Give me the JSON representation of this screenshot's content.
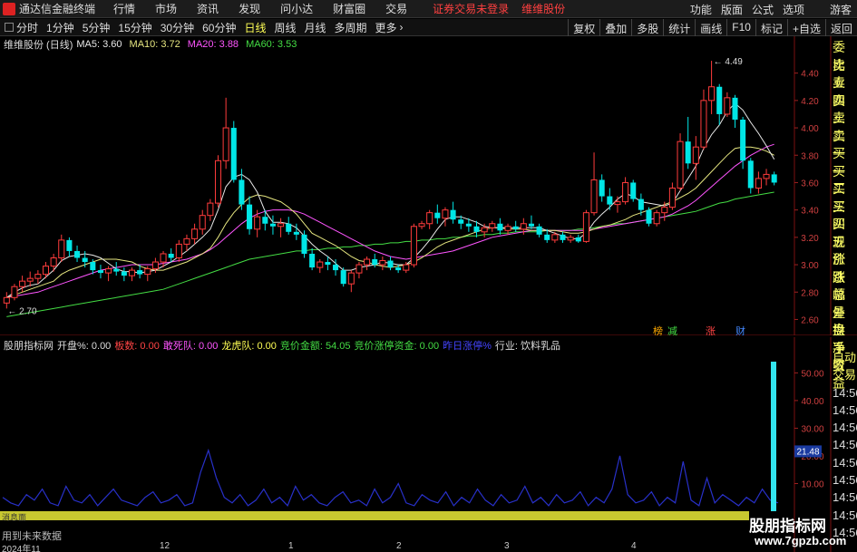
{
  "menubar": {
    "app_title": "通达信金融终端",
    "menus": [
      "行情",
      "市场",
      "资讯",
      "发现",
      "问小达",
      "财富圈",
      "交易"
    ],
    "login_status": "证券交易未登录",
    "stock_name": "维维股份",
    "right_menus": [
      "功能",
      "版面",
      "公式",
      "选项"
    ],
    "guest": "游客"
  },
  "toolbar": {
    "periods": [
      "分时",
      "1分钟",
      "5分钟",
      "15分钟",
      "30分钟",
      "60分钟",
      "日线",
      "周线",
      "月线",
      "多周期",
      "更多"
    ],
    "active_period": "日线",
    "right_buttons": [
      "复权",
      "叠加",
      "多股",
      "统计",
      "画线",
      "F10",
      "标记",
      "+自选",
      "返回"
    ]
  },
  "main_legend": {
    "title": "维维股份 (日线)",
    "ma5": "MA5: 3.60",
    "ma10": "MA10: 3.72",
    "ma20": "MA20: 3.88",
    "ma60": "MA60: 3.53",
    "colors": {
      "ma5": "#e8e8e8",
      "ma10": "#e6e680",
      "ma20": "#ff55ff",
      "ma60": "#44dd44"
    }
  },
  "sub_legend": {
    "title": "股朋指标网",
    "kaipan": "开盘%: 0.00",
    "banshu": "板数: 0.00",
    "gansidui": "敢死队: 0.00",
    "longhudui": "龙虎队: 0.00",
    "jingjiajine": "竞价金额: 54.05",
    "jingjiazhangting": "竞价涨停资金: 0.00",
    "zuorizhangting": "昨日涨停%",
    "industry": "行业: 饮料乳品"
  },
  "price_axis": [
    "4.40",
    "4.20",
    "4.00",
    "3.80",
    "3.60",
    "3.40",
    "3.20",
    "3.00",
    "2.80",
    "2.60"
  ],
  "sub_axis": [
    "50.00",
    "40.00",
    "30.00",
    "20.00",
    "10.00"
  ],
  "highlighted_value": "21.48",
  "annotations": {
    "high": "4.49",
    "low": "2.70"
  },
  "event_tags": [
    "榜",
    "减",
    "涨",
    "财"
  ],
  "side_panel": [
    "委比",
    "卖五",
    "卖四",
    "卖三",
    "卖二",
    "卖一",
    "买一",
    "买二",
    "买三",
    "买四",
    "买五",
    "现价",
    "涨跌",
    "涨幅",
    "总量",
    "外盘",
    "换手",
    "净资",
    "收益"
  ],
  "side_panel2": [
    "自动",
    "交易",
    "14:56",
    "14:56",
    "14:56",
    "14:56",
    "14:56",
    "14:56",
    "14:56",
    "14:56",
    "14:56"
  ],
  "scrollbar_label": "消息面",
  "future_label": "用到未来数据",
  "x_labels": [
    "2024年11",
    "12",
    "1",
    "2",
    "3",
    "4"
  ],
  "watermark": {
    "line1": "股朋指标网",
    "line2": "www.7gpzb.com"
  },
  "chart_data": {
    "type": "candlestick",
    "title": "维维股份 (日线)",
    "ylim": [
      2.55,
      4.55
    ],
    "candles": [
      [
        2.72,
        2.8,
        2.68,
        2.76
      ],
      [
        2.76,
        2.86,
        2.74,
        2.84
      ],
      [
        2.84,
        2.92,
        2.8,
        2.88
      ],
      [
        2.88,
        2.95,
        2.84,
        2.9
      ],
      [
        2.9,
        2.96,
        2.86,
        2.93
      ],
      [
        2.93,
        3.02,
        2.9,
        2.99
      ],
      [
        2.99,
        3.08,
        2.95,
        3.05
      ],
      [
        3.05,
        3.22,
        3.02,
        3.18
      ],
      [
        3.18,
        3.2,
        3.06,
        3.1
      ],
      [
        3.1,
        3.14,
        3.02,
        3.05
      ],
      [
        3.05,
        3.1,
        2.98,
        3.02
      ],
      [
        3.02,
        3.04,
        2.93,
        2.96
      ],
      [
        2.96,
        3.0,
        2.9,
        2.94
      ],
      [
        2.94,
        2.99,
        2.88,
        2.97
      ],
      [
        2.97,
        3.02,
        2.92,
        2.95
      ],
      [
        2.95,
        2.98,
        2.88,
        2.92
      ],
      [
        2.92,
        2.98,
        2.88,
        2.96
      ],
      [
        2.96,
        3.0,
        2.9,
        2.93
      ],
      [
        2.93,
        2.99,
        2.88,
        2.97
      ],
      [
        2.97,
        3.05,
        2.94,
        3.02
      ],
      [
        3.02,
        3.1,
        2.98,
        3.08
      ],
      [
        3.08,
        3.12,
        3.02,
        3.05
      ],
      [
        3.05,
        3.18,
        3.02,
        3.15
      ],
      [
        3.15,
        3.22,
        3.1,
        3.19
      ],
      [
        3.19,
        3.3,
        3.15,
        3.26
      ],
      [
        3.26,
        3.4,
        3.22,
        3.36
      ],
      [
        3.36,
        3.48,
        3.32,
        3.45
      ],
      [
        3.45,
        3.8,
        3.42,
        3.76
      ],
      [
        3.76,
        4.22,
        3.7,
        4.0
      ],
      [
        4.0,
        4.05,
        3.6,
        3.62
      ],
      [
        3.62,
        3.7,
        3.4,
        3.44
      ],
      [
        3.44,
        3.5,
        3.22,
        3.26
      ],
      [
        3.26,
        3.4,
        3.2,
        3.35
      ],
      [
        3.35,
        3.4,
        3.25,
        3.3
      ],
      [
        3.3,
        3.36,
        3.22,
        3.28
      ],
      [
        3.28,
        3.34,
        3.2,
        3.3
      ],
      [
        3.3,
        3.35,
        3.22,
        3.24
      ],
      [
        3.24,
        3.3,
        3.18,
        3.22
      ],
      [
        3.22,
        3.25,
        3.05,
        3.08
      ],
      [
        3.08,
        3.12,
        2.96,
        2.98
      ],
      [
        2.98,
        3.04,
        2.94,
        3.02
      ],
      [
        3.02,
        3.06,
        2.96,
        3.0
      ],
      [
        3.0,
        3.04,
        2.92,
        2.96
      ],
      [
        2.96,
        2.98,
        2.84,
        2.86
      ],
      [
        2.86,
        2.96,
        2.8,
        2.94
      ],
      [
        2.94,
        3.02,
        2.9,
        3.0
      ],
      [
        3.0,
        3.06,
        2.96,
        3.04
      ],
      [
        3.04,
        3.08,
        2.98,
        3.0
      ],
      [
        3.0,
        3.06,
        2.96,
        3.03
      ],
      [
        3.03,
        3.06,
        2.96,
        2.98
      ],
      [
        2.98,
        3.0,
        2.94,
        2.96
      ],
      [
        2.96,
        3.02,
        2.94,
        3.0
      ],
      [
        3.0,
        3.3,
        2.98,
        3.28
      ],
      [
        3.28,
        3.32,
        3.26,
        3.3
      ],
      [
        3.3,
        3.4,
        3.26,
        3.38
      ],
      [
        3.38,
        3.44,
        3.3,
        3.34
      ],
      [
        3.34,
        3.42,
        3.28,
        3.4
      ],
      [
        3.4,
        3.46,
        3.3,
        3.33
      ],
      [
        3.33,
        3.36,
        3.26,
        3.3
      ],
      [
        3.3,
        3.34,
        3.24,
        3.28
      ],
      [
        3.28,
        3.32,
        3.2,
        3.24
      ],
      [
        3.24,
        3.3,
        3.2,
        3.27
      ],
      [
        3.27,
        3.32,
        3.24,
        3.3
      ],
      [
        3.3,
        3.34,
        3.22,
        3.25
      ],
      [
        3.25,
        3.3,
        3.22,
        3.28
      ],
      [
        3.28,
        3.32,
        3.24,
        3.26
      ],
      [
        3.26,
        3.34,
        3.22,
        3.3
      ],
      [
        3.3,
        3.36,
        3.26,
        3.28
      ],
      [
        3.28,
        3.3,
        3.2,
        3.22
      ],
      [
        3.22,
        3.26,
        3.16,
        3.18
      ],
      [
        3.18,
        3.24,
        3.16,
        3.22
      ],
      [
        3.22,
        3.24,
        3.16,
        3.18
      ],
      [
        3.18,
        3.22,
        3.16,
        3.2
      ],
      [
        3.2,
        3.22,
        3.16,
        3.17
      ],
      [
        3.17,
        3.4,
        3.16,
        3.38
      ],
      [
        3.38,
        3.82,
        3.36,
        3.62
      ],
      [
        3.62,
        3.66,
        3.46,
        3.5
      ],
      [
        3.5,
        3.56,
        3.4,
        3.44
      ],
      [
        3.44,
        3.5,
        3.38,
        3.46
      ],
      [
        3.46,
        3.64,
        3.44,
        3.6
      ],
      [
        3.6,
        3.62,
        3.46,
        3.48
      ],
      [
        3.48,
        3.52,
        3.36,
        3.4
      ],
      [
        3.4,
        3.42,
        3.28,
        3.3
      ],
      [
        3.3,
        3.4,
        3.28,
        3.38
      ],
      [
        3.38,
        3.46,
        3.32,
        3.42
      ],
      [
        3.42,
        3.6,
        3.4,
        3.56
      ],
      [
        3.56,
        3.96,
        3.54,
        3.9
      ],
      [
        3.9,
        4.08,
        3.7,
        3.74
      ],
      [
        3.74,
        3.94,
        3.62,
        3.86
      ],
      [
        3.86,
        4.28,
        3.84,
        4.2
      ],
      [
        4.2,
        4.49,
        4.1,
        4.3
      ],
      [
        4.3,
        4.32,
        4.02,
        4.1
      ],
      [
        4.1,
        4.26,
        4.08,
        4.22
      ],
      [
        4.22,
        4.24,
        4.0,
        4.06
      ],
      [
        4.06,
        4.08,
        3.7,
        3.76
      ],
      [
        3.76,
        3.78,
        3.52,
        3.56
      ],
      [
        3.56,
        3.68,
        3.52,
        3.63
      ],
      [
        3.63,
        3.7,
        3.58,
        3.66
      ],
      [
        3.66,
        3.68,
        3.58,
        3.6
      ]
    ],
    "ma5": [
      2.76,
      2.8,
      2.83,
      2.85,
      2.86,
      2.91,
      2.96,
      3.03,
      3.06,
      3.07,
      3.08,
      3.07,
      3.05,
      3.01,
      2.97,
      2.95,
      2.95,
      2.94,
      2.95,
      2.96,
      2.99,
      3.02,
      3.06,
      3.1,
      3.15,
      3.2,
      3.26,
      3.4,
      3.57,
      3.64,
      3.66,
      3.62,
      3.53,
      3.39,
      3.31,
      3.31,
      3.3,
      3.27,
      3.21,
      3.15,
      3.1,
      3.06,
      3.01,
      2.96,
      2.96,
      2.98,
      2.99,
      3.0,
      3.02,
      3.01,
      3.0,
      3.0,
      3.05,
      3.11,
      3.18,
      3.26,
      3.33,
      3.35,
      3.35,
      3.33,
      3.31,
      3.28,
      3.27,
      3.27,
      3.27,
      3.27,
      3.27,
      3.27,
      3.27,
      3.25,
      3.23,
      3.21,
      3.19,
      3.19,
      3.23,
      3.31,
      3.37,
      3.42,
      3.48,
      3.52,
      3.5,
      3.46,
      3.45,
      3.44,
      3.43,
      3.45,
      3.54,
      3.63,
      3.72,
      3.85,
      3.95,
      4.02,
      4.12,
      4.18,
      4.13,
      4.04,
      3.96,
      3.87,
      3.77
    ],
    "ma10": [
      2.76,
      2.78,
      2.8,
      2.82,
      2.84,
      2.86,
      2.88,
      2.93,
      2.96,
      2.98,
      3.0,
      3.02,
      3.04,
      3.04,
      3.04,
      3.03,
      3.02,
      2.99,
      2.97,
      2.96,
      2.96,
      2.98,
      3.0,
      3.02,
      3.05,
      3.08,
      3.12,
      3.2,
      3.3,
      3.38,
      3.44,
      3.49,
      3.51,
      3.5,
      3.48,
      3.46,
      3.42,
      3.37,
      3.3,
      3.23,
      3.2,
      3.17,
      3.14,
      3.1,
      3.06,
      3.03,
      3.02,
      3.0,
      2.99,
      2.98,
      2.99,
      3.0,
      3.02,
      3.05,
      3.09,
      3.13,
      3.16,
      3.18,
      3.2,
      3.22,
      3.24,
      3.26,
      3.27,
      3.27,
      3.26,
      3.26,
      3.26,
      3.25,
      3.25,
      3.25,
      3.25,
      3.24,
      3.23,
      3.23,
      3.24,
      3.26,
      3.28,
      3.29,
      3.31,
      3.33,
      3.36,
      3.38,
      3.4,
      3.42,
      3.44,
      3.46,
      3.49,
      3.52,
      3.56,
      3.62,
      3.68,
      3.74,
      3.8,
      3.85,
      3.86,
      3.86,
      3.85,
      3.83,
      3.8
    ],
    "ma20": [
      2.76,
      2.77,
      2.78,
      2.79,
      2.8,
      2.82,
      2.84,
      2.86,
      2.88,
      2.9,
      2.92,
      2.94,
      2.96,
      2.97,
      2.98,
      2.99,
      3.0,
      3.0,
      3.0,
      3.0,
      3.01,
      3.02,
      3.03,
      3.04,
      3.06,
      3.08,
      3.11,
      3.15,
      3.2,
      3.25,
      3.3,
      3.34,
      3.37,
      3.39,
      3.4,
      3.4,
      3.4,
      3.39,
      3.37,
      3.34,
      3.31,
      3.28,
      3.25,
      3.22,
      3.19,
      3.16,
      3.13,
      3.1,
      3.08,
      3.06,
      3.05,
      3.04,
      3.05,
      3.06,
      3.07,
      3.08,
      3.09,
      3.1,
      3.12,
      3.14,
      3.16,
      3.18,
      3.2,
      3.21,
      3.22,
      3.23,
      3.24,
      3.25,
      3.25,
      3.25,
      3.25,
      3.25,
      3.25,
      3.25,
      3.25,
      3.26,
      3.27,
      3.28,
      3.29,
      3.3,
      3.31,
      3.32,
      3.33,
      3.34,
      3.35,
      3.37,
      3.4,
      3.43,
      3.47,
      3.52,
      3.57,
      3.62,
      3.67,
      3.72,
      3.76,
      3.8,
      3.83,
      3.86,
      3.88
    ],
    "ma60": [
      2.62,
      2.63,
      2.64,
      2.65,
      2.66,
      2.67,
      2.68,
      2.69,
      2.7,
      2.71,
      2.72,
      2.73,
      2.74,
      2.75,
      2.76,
      2.77,
      2.78,
      2.79,
      2.8,
      2.81,
      2.82,
      2.84,
      2.86,
      2.88,
      2.9,
      2.92,
      2.94,
      2.96,
      2.98,
      3.0,
      3.02,
      3.04,
      3.05,
      3.06,
      3.07,
      3.08,
      3.09,
      3.1,
      3.1,
      3.11,
      3.11,
      3.12,
      3.12,
      3.13,
      3.13,
      3.14,
      3.14,
      3.15,
      3.15,
      3.16,
      3.16,
      3.17,
      3.17,
      3.18,
      3.18,
      3.19,
      3.19,
      3.2,
      3.2,
      3.21,
      3.21,
      3.22,
      3.22,
      3.23,
      3.23,
      3.24,
      3.24,
      3.24,
      3.24,
      3.25,
      3.25,
      3.25,
      3.25,
      3.26,
      3.26,
      3.27,
      3.28,
      3.29,
      3.3,
      3.3,
      3.31,
      3.32,
      3.33,
      3.34,
      3.35,
      3.36,
      3.37,
      3.38,
      3.39,
      3.41,
      3.43,
      3.45,
      3.46,
      3.48,
      3.49,
      3.5,
      3.51,
      3.52,
      3.53
    ],
    "indicator_line": [
      5,
      3,
      2,
      6,
      4,
      8,
      3,
      2,
      9,
      4,
      3,
      6,
      2,
      5,
      8,
      4,
      3,
      2,
      5,
      7,
      3,
      4,
      6,
      2,
      3,
      14,
      22,
      12,
      5,
      3,
      6,
      2,
      4,
      8,
      3,
      5,
      2,
      9,
      4,
      6,
      3,
      2,
      5,
      7,
      3,
      4,
      2,
      8,
      3,
      5,
      10,
      3,
      2,
      6,
      4,
      3,
      7,
      2,
      5,
      3,
      8,
      4,
      2,
      6,
      3,
      4,
      9,
      3,
      5,
      2,
      6,
      3,
      4,
      7,
      2,
      5,
      3,
      8,
      20,
      6,
      3,
      4,
      7,
      2,
      5,
      3,
      18,
      4,
      2,
      12,
      3,
      6,
      4,
      2,
      5,
      3,
      8,
      4,
      3
    ],
    "indicator_bar": 54.05,
    "sub_ylim": [
      0,
      57
    ]
  }
}
